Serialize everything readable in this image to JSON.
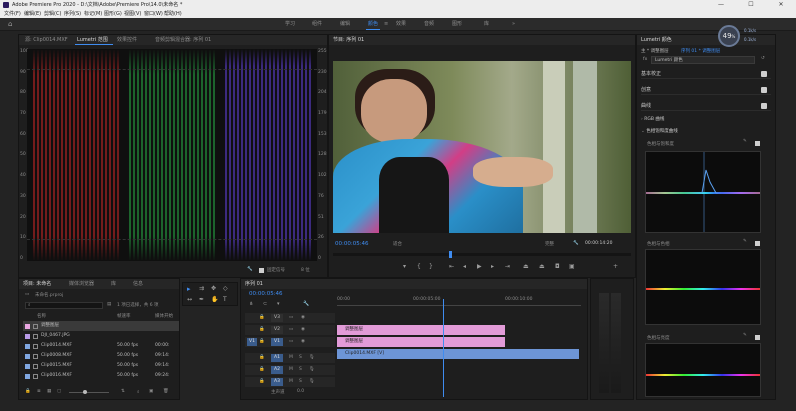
{
  "window": {
    "title": "Adobe Premiere Pro 2020 - D:\\文档\\Adobe\\Premiere Pro\\14.0\\未命名 *",
    "minimize_glyph": "—",
    "maximize_glyph": "☐",
    "close_glyph": "✕"
  },
  "menu": [
    "文件(F)",
    "编辑(E)",
    "剪辑(C)",
    "序列(S)",
    "标记(M)",
    "图形(G)",
    "视图(V)",
    "窗口(W)",
    "帮助(H)"
  ],
  "workspaces": [
    "学习",
    "组件",
    "编辑",
    "颜色",
    "效果",
    "音频",
    "图形",
    "库"
  ],
  "workspace_active_index": 3,
  "workspace_more": "»",
  "scopes_panel": {
    "tabs": [
      "源: Clip0014.MXF",
      "Lumetri 范围",
      "效果控件",
      "音频剪辑混合器: 序列 01"
    ],
    "active_tab_index": 1,
    "left_ticks": [
      "100",
      "90",
      "80",
      "70",
      "60",
      "50",
      "40",
      "30",
      "20",
      "10",
      "0"
    ],
    "right_ticks": [
      "255",
      "230",
      "204",
      "179",
      "153",
      "128",
      "102",
      "76",
      "51",
      "26",
      "0"
    ],
    "footer_label": "固定信号",
    "footer_value": "8 位"
  },
  "program_monitor": {
    "title": "节目: 序列 01",
    "timecode": "00:00:05:46",
    "fit": "适合",
    "quality": "完整",
    "duration": "00:00:14:20"
  },
  "project_panel": {
    "tabs": [
      "项目: 未命名",
      "媒体浏览器",
      "库",
      "信息"
    ],
    "active_tab_index": 0,
    "file_name": "未命名.prproj",
    "selection_info": "1 项已选择，共 6 项",
    "col_name": "名称",
    "col_fps": "帧速率",
    "col_start": "媒体开始",
    "items": [
      {
        "name": "调整图层",
        "fps": "",
        "start": "",
        "color": "#e9a6e1"
      },
      {
        "name": "DJI_0467.JPG",
        "fps": "",
        "start": "",
        "color": "#b99be8"
      },
      {
        "name": "Clip0014.MXF",
        "fps": "50.00 fps",
        "start": "00:00:",
        "color": "#7fa6e0"
      },
      {
        "name": "Clip0008.MXF",
        "fps": "50.00 fps",
        "start": "09:14:",
        "color": "#7fa6e0"
      },
      {
        "name": "Clip0015.MXF",
        "fps": "50.00 fps",
        "start": "09:14:",
        "color": "#7fa6e0"
      },
      {
        "name": "Clip0016.MXF",
        "fps": "50.00 fps",
        "start": "09:24:",
        "color": "#7fa6e0"
      }
    ]
  },
  "timeline": {
    "tab": "序列 01",
    "timecode": "00:00:05:46",
    "ruler": [
      "00:00",
      "00:00:05:00",
      "00:00:10:00"
    ],
    "video_tracks": [
      "V3",
      "V2",
      "V1"
    ],
    "audio_tracks": [
      "A1",
      "A2",
      "A3"
    ],
    "master": "主声道",
    "master_value": "0.0",
    "clips": [
      {
        "label": "调整图层",
        "color": "#e29bd8"
      },
      {
        "label": "调整图层",
        "color": "#e29bd8"
      },
      {
        "label": "Clip0014.MXF [V]",
        "color": "#6d95d6"
      }
    ]
  },
  "lumetri": {
    "title": "Lumetri 颜色",
    "master_label": "主 * 调整图层",
    "seq_label": "序列 01 * 调整图层",
    "fx_label": "fx",
    "fx_name": "Lumetri 颜色",
    "zoom_value": "49",
    "zoom_unit": "%",
    "net_up": "0.1k/s",
    "net_down": "0.1k/s",
    "rows": [
      "基本校正",
      "创意",
      "曲线"
    ],
    "rgb_curve": "RGB 曲线",
    "hue_section": "色相饱和度曲线",
    "curves": [
      "色相与饱和度",
      "色相与色相",
      "色相与亮度"
    ]
  }
}
